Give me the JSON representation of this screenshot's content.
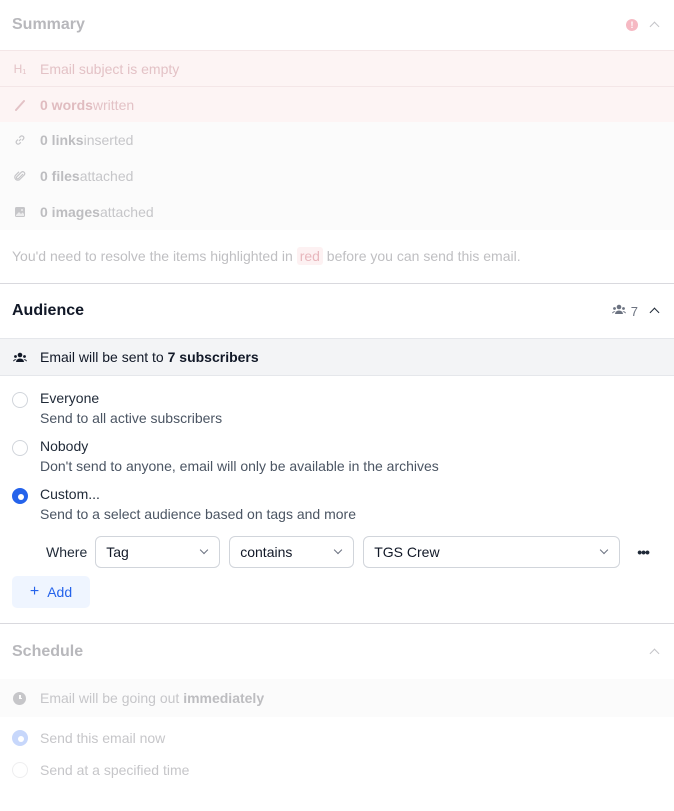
{
  "summary": {
    "title": "Summary",
    "warning_icon": "exclamation-icon",
    "items": [
      {
        "icon": "heading-icon",
        "icon_glyph": "H₁",
        "bold": "",
        "text": "Email subject is empty",
        "state": "error"
      },
      {
        "icon": "pencil-icon",
        "icon_glyph": "∕",
        "bold": "0 words",
        "text": " written",
        "state": "error"
      },
      {
        "icon": "link-icon",
        "icon_glyph": "ℒ",
        "bold": "0 links",
        "text": " inserted",
        "state": "neutral"
      },
      {
        "icon": "paperclip-icon",
        "icon_glyph": "ℒ",
        "bold": "0 files",
        "text": " attached",
        "state": "neutral"
      },
      {
        "icon": "image-icon",
        "icon_glyph": "▣",
        "bold": "0 images",
        "text": " attached",
        "state": "neutral"
      }
    ],
    "note_before": "You'd need to resolve the items highlighted in ",
    "note_highlight": "red",
    "note_after": " before you can send this email."
  },
  "audience": {
    "title": "Audience",
    "count": "7",
    "banner_prefix": "Email will be sent to ",
    "banner_bold": "7 subscribers",
    "options": [
      {
        "label": "Everyone",
        "description": "Send to all active subscribers",
        "checked": false
      },
      {
        "label": "Nobody",
        "description": "Don't send to anyone, email will only be available in the archives",
        "checked": false
      },
      {
        "label": "Custom...",
        "description": "Send to a select audience based on tags and more",
        "checked": true
      }
    ],
    "filter": {
      "where_label": "Where",
      "field": "Tag",
      "operator": "contains",
      "value": "TGS Crew",
      "more_label": "•••"
    },
    "add_label": "Add",
    "add_icon": "+"
  },
  "schedule": {
    "title": "Schedule",
    "banner_prefix": "Email will be going out ",
    "banner_bold": "immediately",
    "options": [
      {
        "label": "Send this email now",
        "checked": true
      },
      {
        "label": "Send at a specified time",
        "checked": false
      }
    ]
  },
  "colors": {
    "accent": "#2563eb",
    "error_bg": "#fdf4f4",
    "warning": "#f6b9c3"
  }
}
